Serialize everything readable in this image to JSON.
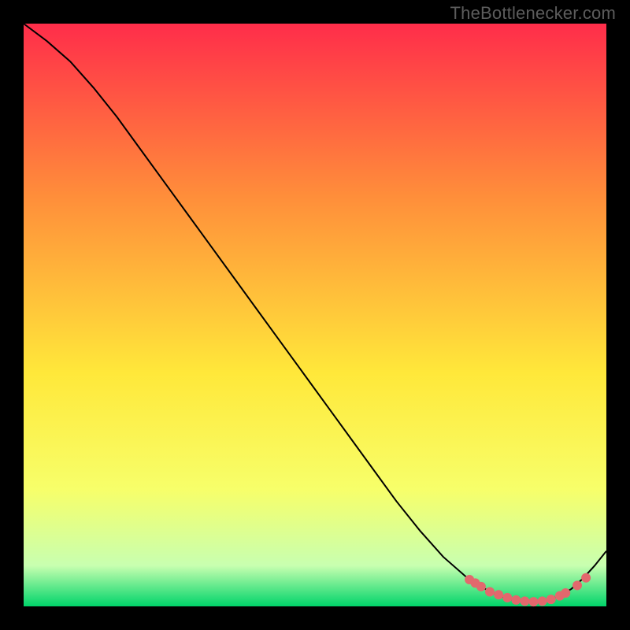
{
  "watermark": "TheBottlenecker.com",
  "colors": {
    "top": "#ff2d4a",
    "mid_upper": "#ff8f3a",
    "mid": "#ffe83a",
    "mid_lower": "#f7ff6a",
    "near_bottom": "#c8ffb0",
    "bottom": "#00d46a",
    "curve": "#000000",
    "marker": "#e2686d"
  },
  "chart_data": {
    "type": "line",
    "title": "",
    "xlabel": "",
    "ylabel": "",
    "xlim": [
      0,
      100
    ],
    "ylim": [
      0,
      100
    ],
    "series": [
      {
        "name": "curve",
        "x": [
          0,
          4,
          8,
          12,
          16,
          20,
          24,
          28,
          32,
          36,
          40,
          44,
          48,
          52,
          56,
          60,
          64,
          68,
          72,
          76,
          80,
          82,
          84,
          86,
          88,
          90,
          92,
          94,
          96,
          98,
          100
        ],
        "y": [
          100,
          97,
          93.5,
          89,
          84,
          78.5,
          73,
          67.5,
          62,
          56.5,
          51,
          45.5,
          40,
          34.5,
          29,
          23.5,
          18,
          13,
          8.5,
          5,
          2.5,
          1.7,
          1.1,
          0.8,
          0.8,
          1.1,
          1.8,
          3,
          4.8,
          7,
          9.5
        ]
      }
    ],
    "markers": {
      "name": "highlight-points",
      "x": [
        76.5,
        77.5,
        78.5,
        80,
        81.5,
        83,
        84.5,
        86,
        87.5,
        89,
        90.5,
        92,
        93,
        95,
        96.5
      ],
      "y": [
        4.6,
        4.0,
        3.4,
        2.5,
        2.0,
        1.5,
        1.1,
        0.9,
        0.8,
        0.9,
        1.2,
        1.8,
        2.3,
        3.6,
        4.9
      ]
    }
  }
}
